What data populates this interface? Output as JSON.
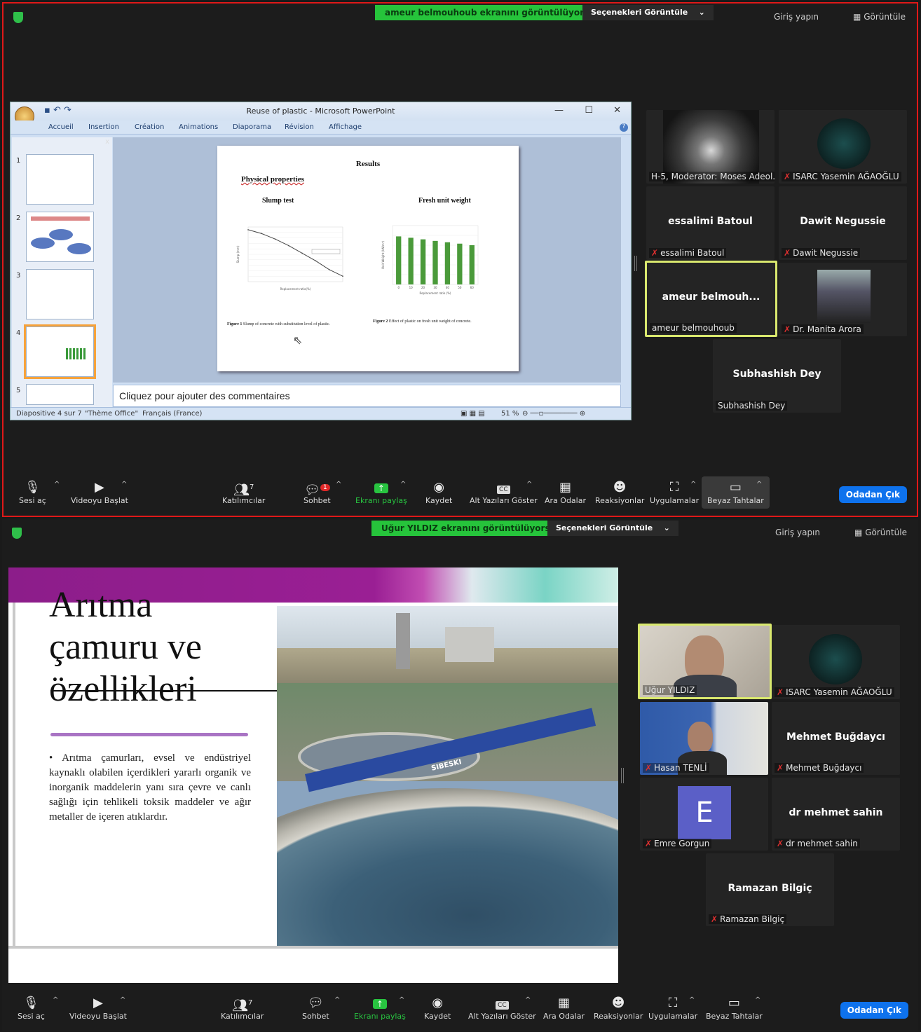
{
  "panel1": {
    "share_banner": "ameur belmouhoub ekranını görüntülüyorsunuz",
    "view_options": "Seçenekleri Görüntüle",
    "sign_in": "Giriş yapın",
    "view": "Görüntüle",
    "ppt": {
      "window_title": "Reuse of plastic - Microsoft PowerPoint",
      "tabs": [
        "Accueil",
        "Insertion",
        "Création",
        "Animations",
        "Diaporama",
        "Révision",
        "Affichage"
      ],
      "thumb_numbers": [
        "1",
        "2",
        "3",
        "4",
        "5"
      ],
      "slide": {
        "title": "Results",
        "subtitle": "Physical properties",
        "chart1_title": "Slump test",
        "chart2_title": "Fresh unit weight",
        "fig1_caption_bold": "Figure 1",
        "fig1_caption": "Slump of concrete with substitution level of plastic.",
        "fig2_caption_bold": "Figure 2",
        "fig2_caption": "Effect of plastic on fresh unit weight of concrete."
      },
      "notes_placeholder": "Cliquez pour ajouter des commentaires",
      "status_slide": "Diapositive 4 sur 7",
      "status_theme": "\"Thème Office\"",
      "status_lang": "Français (France)",
      "zoom": "51 %"
    },
    "participants": [
      {
        "name": "H-5, Moderator: Moses Adeol...",
        "muted": false
      },
      {
        "name": "ISARC Yasemin AĞAOĞLU",
        "muted": true
      },
      {
        "big": "essalimi Batoul",
        "name": "essalimi Batoul",
        "muted": true
      },
      {
        "big": "Dawit Negussie",
        "name": "Dawit Negussie",
        "muted": true
      },
      {
        "big": "ameur  belmouh...",
        "name": "ameur belmouhoub",
        "muted": false
      },
      {
        "name": "Dr. Manita Arora",
        "muted": true
      },
      {
        "big": "Subhashish Dey",
        "name": "Subhashish Dey",
        "muted": false
      }
    ],
    "chat_badge": "1"
  },
  "panel2": {
    "share_banner": "Uğur YILDIZ ekranını görüntülüyorsunuz",
    "view_options": "Seçenekleri Görüntüle",
    "sign_in": "Giriş yapın",
    "view": "Görüntüle",
    "slide": {
      "title_line1": "Arıtma",
      "title_line2": "çamuru ve",
      "title_line3": "özellikleri",
      "bullet": "Arıtma çamurları, evsel ve endüstriyel kaynaklı olabilen içerdikleri yararlı organik ve inorganik maddelerin yanı sıra çevre ve canlı sağlığı için tehlikeli toksik maddeler ve ağır metaller de içeren atıklardır.",
      "photo_text": "SIBESKI"
    },
    "participants": [
      {
        "name": "Uğur YILDIZ",
        "muted": false
      },
      {
        "name": "ISARC Yasemin AĞAOĞLU",
        "muted": true
      },
      {
        "name": "Hasan TENLİ",
        "muted": true
      },
      {
        "big": "Mehmet Buğdaycı",
        "name": "Mehmet Buğdaycı",
        "muted": true
      },
      {
        "avatar": "E",
        "name": "Emre Gorgun",
        "muted": true
      },
      {
        "big": "dr mehmet sahin",
        "name": "dr mehmet sahin",
        "muted": true
      },
      {
        "big": "Ramazan Bilgiç",
        "name": "Ramazan Bilgiç",
        "muted": true
      }
    ]
  },
  "toolbar": {
    "unmute": "Sesi aç",
    "start_video": "Videoyu Başlat",
    "participants": "Katılımcılar",
    "participant_count": "7",
    "chat": "Sohbet",
    "share": "Ekranı paylaş",
    "record": "Kaydet",
    "captions": "Alt Yazıları Göster",
    "breakout": "Ara Odalar",
    "reactions": "Reaksiyonlar",
    "apps": "Uygulamalar",
    "whiteboard": "Beyaz Tahtalar",
    "leave": "Odadan Çık"
  },
  "chart_data": [
    {
      "type": "line",
      "title": "Slump test",
      "xlabel": "Replacement ratio(%)",
      "ylabel": "Slump (mm)",
      "x": [
        0,
        10,
        20,
        30,
        40,
        50,
        60,
        70
      ],
      "values": [
        95,
        88,
        78,
        66,
        52,
        38,
        22,
        10
      ],
      "ylim": [
        0,
        100
      ]
    },
    {
      "type": "bar",
      "title": "Fresh unit weight",
      "xlabel": "Replacement ratio (%)",
      "ylabel": "Unit Weight (kN/m³)",
      "categories": [
        "0",
        "10",
        "20",
        "30",
        "40",
        "50",
        "60"
      ],
      "values": [
        24.5,
        23.8,
        23.0,
        22.2,
        21.5,
        20.8,
        20.0
      ],
      "ylim": [
        0,
        30
      ]
    }
  ]
}
